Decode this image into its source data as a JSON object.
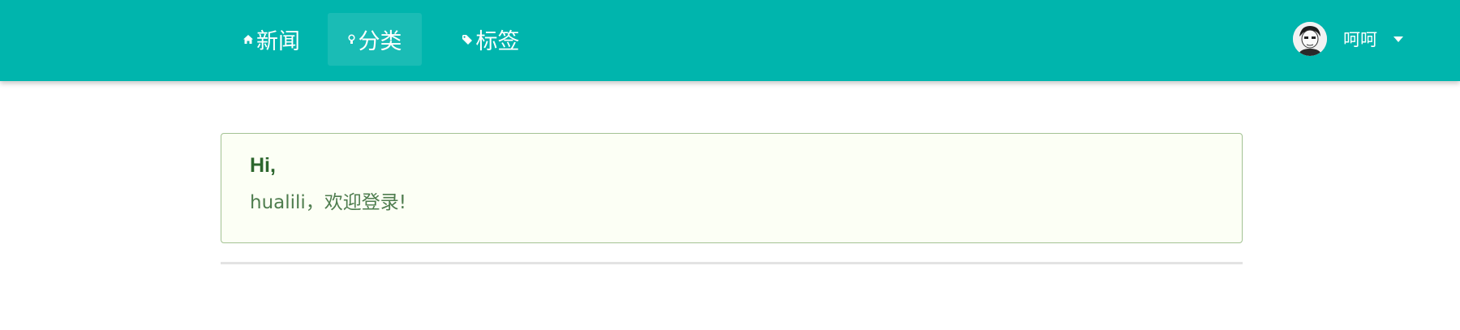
{
  "nav": {
    "items": [
      {
        "label": "新闻",
        "icon": "home-icon",
        "active": false
      },
      {
        "label": "分类",
        "icon": "lightbulb-icon",
        "active": true
      },
      {
        "label": "标签",
        "icon": "tag-icon",
        "active": false
      }
    ]
  },
  "user": {
    "name": "呵呵",
    "avatar": "avatar-icon",
    "menu_icon": "caret-down-icon"
  },
  "message": {
    "header": "Hi,",
    "body": "hualili，欢迎登录!"
  },
  "colors": {
    "navbar": "#00b5ad",
    "message_bg": "#fcfff5",
    "message_border": "#a3c293",
    "message_text": "#2c662d"
  }
}
